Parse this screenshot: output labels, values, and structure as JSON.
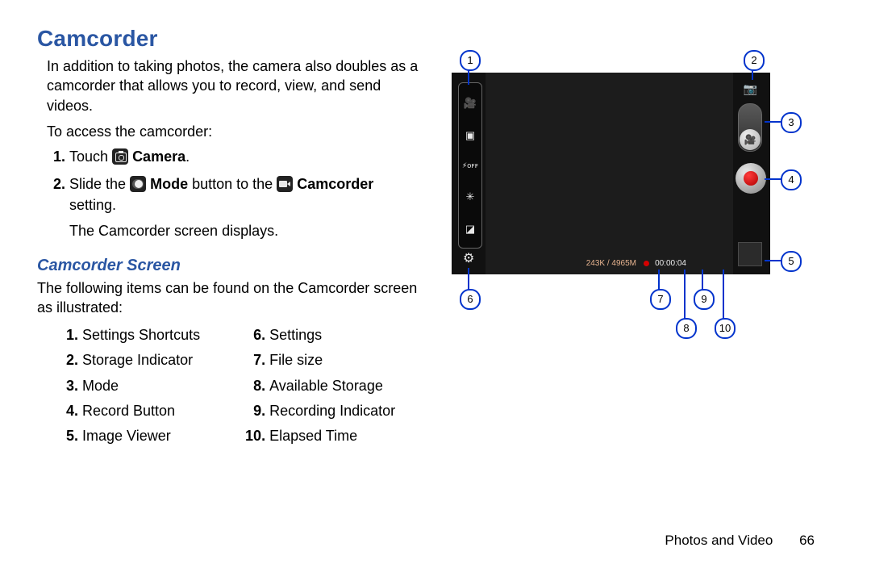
{
  "title": "Camcorder",
  "intro": "In addition to taking photos, the camera also doubles as a camcorder that allows you to record, view, and send videos.",
  "access_line": "To access the camcorder:",
  "steps": {
    "s1_a": "Touch ",
    "s1_b": "Camera",
    "s1_c": ".",
    "s2_a": "Slide the ",
    "s2_b": "Mode",
    "s2_c": " button to the ",
    "s2_d": "Camcorder",
    "s2_e": " setting.",
    "s2_sub": "The Camcorder screen displays."
  },
  "subtitle": "Camcorder Screen",
  "sub_intro": "The following items can be found on the Camcorder screen as illustrated:",
  "legend_left": [
    "Settings Shortcuts",
    "Storage Indicator",
    "Mode",
    "Record Button",
    "Image Viewer"
  ],
  "legend_right": [
    "Settings",
    "File size",
    "Available Storage",
    "Recording Indicator",
    "Elapsed Time"
  ],
  "callouts": {
    "c1": "1",
    "c2": "2",
    "c3": "3",
    "c4": "4",
    "c5": "5",
    "c6": "6",
    "c7": "7",
    "c8": "8",
    "c9": "9",
    "c10": "10"
  },
  "camcorder_ui": {
    "file_size": "243K / 4965M",
    "elapsed": "00:00:04"
  },
  "footer": {
    "section": "Photos and Video",
    "page": "66"
  }
}
